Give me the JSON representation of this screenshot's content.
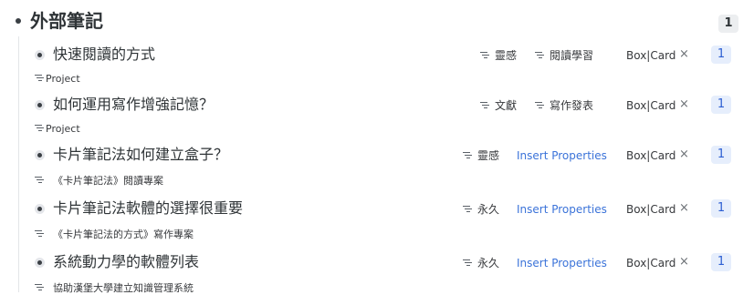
{
  "root": {
    "title": "外部筆記",
    "count": "1"
  },
  "items": [
    {
      "title": "快速閱讀的方式",
      "tags": [
        "靈感",
        "閱讀學習"
      ],
      "insert_label": "",
      "boxcard": "Box|Card",
      "close": "×",
      "count": "1",
      "sub": "Project"
    },
    {
      "title": "如何運用寫作增強記憶？",
      "tags": [
        "文獻",
        "寫作發表"
      ],
      "insert_label": "",
      "boxcard": "Box|Card",
      "close": "×",
      "count": "1",
      "sub": "Project"
    },
    {
      "title": "卡片筆記法如何建立盒子？",
      "tags": [
        "靈感"
      ],
      "insert_label": "Insert Properties",
      "boxcard": "Box|Card",
      "close": "×",
      "count": "1",
      "sub": "《卡片筆記法》閱讀專案"
    },
    {
      "title": "卡片筆記法軟體的選擇很重要",
      "tags": [
        "永久"
      ],
      "insert_label": "Insert Properties",
      "boxcard": "Box|Card",
      "close": "×",
      "count": "1",
      "sub": "《卡片筆記法的方式》寫作專案"
    },
    {
      "title": "系統動力學的軟體列表",
      "tags": [
        "永久"
      ],
      "insert_label": "Insert Properties",
      "boxcard": "Box|Card",
      "close": "×",
      "count": "1",
      "sub": "協助漢堡大學建立知識管理系統"
    }
  ],
  "colors": {
    "accent": "#3b73d9",
    "badge_bg": "#e6eefc",
    "text": "#2f3437"
  },
  "icons": {
    "tag": "list-icon",
    "bullet": "bullet-icon",
    "remove": "close-icon"
  }
}
